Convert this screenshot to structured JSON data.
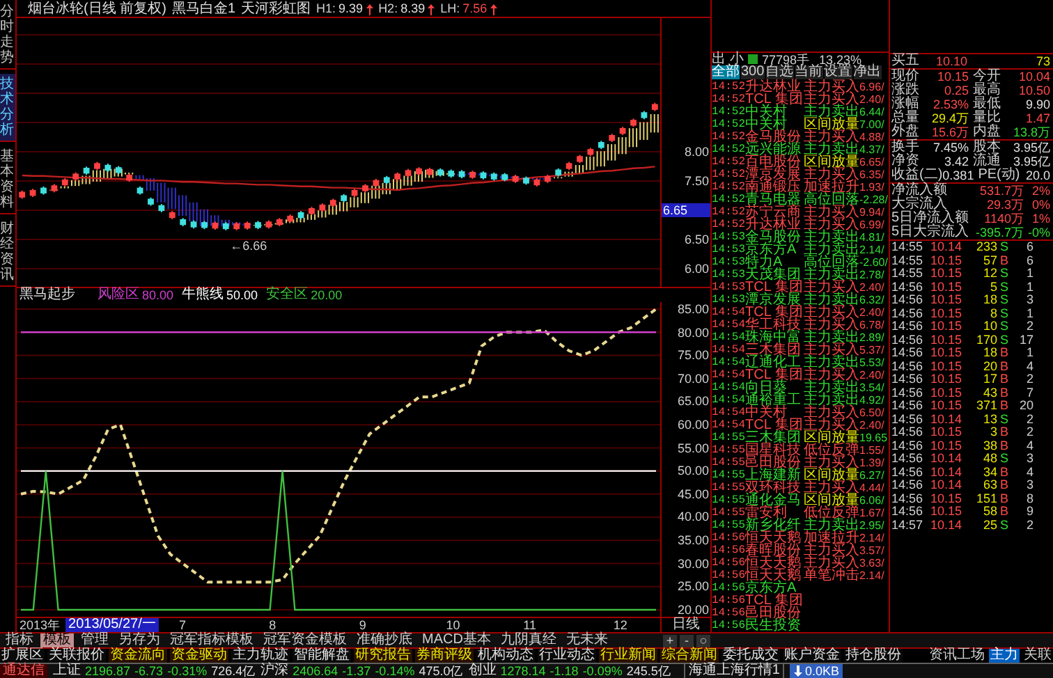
{
  "side_tabs": [
    {
      "label": "分时走势",
      "selected": false
    },
    {
      "label": "技术分析",
      "selected": true
    },
    {
      "label": "基本资料",
      "selected": false
    },
    {
      "label": "财经资讯",
      "selected": false
    }
  ],
  "chart_title": {
    "stock": "烟台冰轮(日线 前复权)",
    "indicator": "黑马白金1",
    "overlay": "天河彩虹图",
    "values": [
      {
        "label": "H1:",
        "value": "9.39",
        "color": "#e0e0e0"
      },
      {
        "label": "H2:",
        "value": "8.39",
        "color": "#e0e0e0"
      },
      {
        "label": "LH:",
        "value": "7.56",
        "color": "#ff4a4a"
      }
    ]
  },
  "price_chart": {
    "chart_data": {
      "type": "candlestick",
      "yticks": [
        {
          "value": 8,
          "label": "8.00"
        },
        {
          "value": 7.5,
          "label": "7.50"
        },
        {
          "value": 6.5,
          "label": "6.50"
        },
        {
          "value": 6,
          "label": "6.00"
        }
      ],
      "ylim": [
        5.67,
        10.29
      ],
      "grid": true,
      "categories": [
        null,
        null,
        null,
        null,
        null,
        null,
        null,
        null,
        null,
        null,
        null,
        null,
        null,
        null,
        null,
        null,
        null,
        null,
        null,
        null,
        null,
        null,
        null,
        null,
        null,
        null,
        null,
        null,
        null,
        null,
        null,
        null,
        null,
        null,
        null,
        null,
        null,
        null,
        null,
        null,
        null,
        null,
        null,
        null,
        null,
        null,
        null,
        null,
        null,
        null,
        null,
        null,
        null,
        null,
        null,
        null,
        null,
        null,
        null,
        null
      ],
      "series": [
        {
          "type": "line",
          "color": "#c02020",
          "values": [
            7.6,
            7.59,
            7.59,
            7.58,
            7.57,
            7.56,
            7.56,
            7.55,
            7.54,
            7.54,
            7.53,
            7.52,
            7.51,
            7.51,
            7.5,
            7.49,
            7.49,
            7.48,
            7.47,
            7.46,
            7.46,
            7.45,
            7.44,
            7.44,
            7.43,
            7.42,
            7.41,
            7.41,
            7.4,
            7.39,
            7.39,
            7.38,
            7.37,
            7.36,
            7.36,
            7.35,
            7.37,
            7.38,
            7.4,
            7.42,
            7.43,
            7.45,
            7.47,
            7.48,
            7.5,
            7.52,
            7.53,
            7.55,
            7.57,
            7.58,
            7.6,
            7.62,
            7.63,
            7.65,
            7.67,
            7.68,
            7.7,
            7.72,
            7.73,
            7.75
          ]
        }
      ],
      "ohlc": [
        [
          7.23,
          7.34,
          7.2,
          7.31
        ],
        [
          7.26,
          7.37,
          7.23,
          7.34
        ],
        [
          7.38,
          7.41,
          7.27,
          7.3
        ],
        [
          7.34,
          7.45,
          7.31,
          7.42
        ],
        [
          7.44,
          7.55,
          7.41,
          7.52
        ],
        [
          7.54,
          7.65,
          7.51,
          7.62
        ],
        [
          7.72,
          7.75,
          7.61,
          7.64
        ],
        [
          7.72,
          7.83,
          7.69,
          7.8
        ],
        [
          7.77,
          7.8,
          7.66,
          7.69
        ],
        [
          7.73,
          7.76,
          7.62,
          7.65
        ],
        [
          7.52,
          7.63,
          7.49,
          7.6
        ],
        [
          7.38,
          7.41,
          7.27,
          7.3
        ],
        [
          7.19,
          7.22,
          7.08,
          7.11
        ],
        [
          7.08,
          7.11,
          6.97,
          7.0
        ],
        [
          6.88,
          6.99,
          6.85,
          6.96
        ],
        [
          6.84,
          6.87,
          6.73,
          6.76
        ],
        [
          6.8,
          6.83,
          6.69,
          6.72
        ],
        [
          6.79,
          6.82,
          6.68,
          6.71
        ],
        [
          6.7,
          6.81,
          6.67,
          6.78
        ],
        [
          6.77,
          6.8,
          6.66,
          6.69
        ],
        [
          6.69,
          6.8,
          6.66,
          6.77
        ],
        [
          6.7,
          6.81,
          6.67,
          6.78
        ],
        [
          6.79,
          6.82,
          6.68,
          6.71
        ],
        [
          6.72,
          6.83,
          6.69,
          6.8
        ],
        [
          6.76,
          6.87,
          6.73,
          6.84
        ],
        [
          6.82,
          6.93,
          6.79,
          6.9
        ],
        [
          6.96,
          6.99,
          6.85,
          6.88
        ],
        [
          6.95,
          7.06,
          6.92,
          7.03
        ],
        [
          7.01,
          7.12,
          6.98,
          7.09
        ],
        [
          7.09,
          7.2,
          7.06,
          7.17
        ],
        [
          7.25,
          7.28,
          7.14,
          7.17
        ],
        [
          7.26,
          7.37,
          7.23,
          7.34
        ],
        [
          7.34,
          7.45,
          7.31,
          7.42
        ],
        [
          7.43,
          7.54,
          7.4,
          7.51
        ],
        [
          7.56,
          7.59,
          7.45,
          7.48
        ],
        [
          7.54,
          7.65,
          7.51,
          7.62
        ],
        [
          7.6,
          7.71,
          7.57,
          7.68
        ],
        [
          7.63,
          7.74,
          7.6,
          7.71
        ],
        [
          7.62,
          7.73,
          7.59,
          7.7
        ],
        [
          7.69,
          7.72,
          7.58,
          7.61
        ],
        [
          7.67,
          7.7,
          7.56,
          7.59
        ],
        [
          7.66,
          7.69,
          7.55,
          7.58
        ],
        [
          7.57,
          7.68,
          7.54,
          7.65
        ],
        [
          7.64,
          7.67,
          7.53,
          7.56
        ],
        [
          7.62,
          7.65,
          7.51,
          7.54
        ],
        [
          7.61,
          7.64,
          7.5,
          7.53
        ],
        [
          7.5,
          7.61,
          7.47,
          7.58
        ],
        [
          7.55,
          7.58,
          7.44,
          7.47
        ],
        [
          7.44,
          7.55,
          7.41,
          7.52
        ],
        [
          7.5,
          7.61,
          7.47,
          7.58
        ],
        [
          7.69,
          7.72,
          7.58,
          7.61
        ],
        [
          7.72,
          7.83,
          7.69,
          7.8
        ],
        [
          7.84,
          7.95,
          7.81,
          7.92
        ],
        [
          7.96,
          8.07,
          7.93,
          8.04
        ],
        [
          8.16,
          8.19,
          8.05,
          8.08
        ],
        [
          8.2,
          8.31,
          8.17,
          8.28
        ],
        [
          8.32,
          8.43,
          8.29,
          8.4
        ],
        [
          8.46,
          8.57,
          8.43,
          8.54
        ],
        [
          8.67,
          8.7,
          8.56,
          8.59
        ],
        [
          8.73,
          8.84,
          8.7,
          8.81
        ]
      ]
    }
  },
  "cursor_price": "6.65",
  "low_marker": "←6.66",
  "indicator": {
    "legend": [
      {
        "label": "风险区",
        "value": "80.00",
        "color": "#d040d0"
      },
      {
        "label": "牛熊线",
        "value": "50.00",
        "color": "#ffffff"
      },
      {
        "label": "安全区",
        "value": "20.00",
        "color": "#40c040"
      }
    ],
    "chart_data": {
      "type": "line",
      "title": "黑马起步",
      "ylim": [
        20,
        85
      ],
      "grid": true,
      "yticks": [
        {
          "value": 85,
          "label": "85.00"
        },
        {
          "value": 80,
          "label": "80.00"
        },
        {
          "value": 75,
          "label": "75.00"
        },
        {
          "value": 70,
          "label": "70.00"
        },
        {
          "value": 65,
          "label": "65.00"
        },
        {
          "value": 60,
          "label": "60.00"
        },
        {
          "value": 55,
          "label": "55.00"
        },
        {
          "value": 50,
          "label": "50.00"
        },
        {
          "value": 45,
          "label": "45.00"
        },
        {
          "value": 40,
          "label": "40.00"
        },
        {
          "value": 35,
          "label": "35.00"
        },
        {
          "value": 30,
          "label": "30.00"
        },
        {
          "value": 25,
          "label": "25.00"
        },
        {
          "value": 20,
          "label": "20.00"
        }
      ],
      "series": [
        {
          "color": "#e8d890",
          "line_style": "dashed",
          "values": [
            45,
            45.6,
            45.5,
            45,
            46.5,
            48,
            53,
            59,
            60,
            52,
            44,
            36,
            32,
            30,
            28,
            26,
            26,
            26,
            26,
            26,
            26,
            26.5,
            30,
            33,
            36,
            42,
            48,
            53,
            58,
            60,
            62,
            64,
            66,
            66,
            67,
            68,
            69,
            77,
            79,
            80,
            80,
            80,
            80.5,
            78,
            76,
            75,
            76,
            78,
            80,
            81,
            83,
            85
          ]
        },
        {
          "color": "#d040d0",
          "values": [
            80,
            80,
            80,
            80,
            80,
            80,
            80,
            80,
            80,
            80,
            80,
            80,
            80,
            80,
            80,
            80,
            80,
            80,
            80,
            80,
            80,
            80,
            80,
            80,
            80,
            80,
            80,
            80,
            80,
            80,
            80,
            80,
            80,
            80,
            80,
            80,
            80,
            80,
            80,
            80,
            80,
            80,
            80,
            80,
            80,
            80,
            80,
            80,
            80,
            80,
            80,
            80
          ]
        },
        {
          "color": "#ffffff",
          "values": [
            50,
            50,
            50,
            50,
            50,
            50,
            50,
            50,
            50,
            50,
            50,
            50,
            50,
            50,
            50,
            50,
            50,
            50,
            50,
            50,
            50,
            50,
            50,
            50,
            50,
            50,
            50,
            50,
            50,
            50,
            50,
            50,
            50,
            50,
            50,
            50,
            50,
            50,
            50,
            50,
            50,
            50,
            50,
            50,
            50,
            50,
            50,
            50,
            50,
            50,
            50,
            50
          ]
        },
        {
          "color": "#40c040",
          "values": [
            20,
            20,
            50,
            20,
            20,
            20,
            20,
            20,
            20,
            20,
            20,
            20,
            20,
            20,
            20,
            20,
            20,
            20,
            20,
            20,
            20,
            50,
            20,
            20,
            20,
            20,
            20,
            20,
            20,
            20,
            20,
            20,
            20,
            20,
            20,
            20,
            20,
            20,
            20,
            20,
            20,
            20,
            20,
            20,
            20,
            20,
            20,
            20,
            20,
            20,
            20,
            20
          ]
        }
      ]
    }
  },
  "date_axis": {
    "year": "2013年",
    "cursor_date": "2013/05/27/一",
    "ticks": [
      "7",
      "8",
      "9",
      "10",
      "11",
      "12"
    ],
    "period": "日线"
  },
  "feed": {
    "header": {
      "direction": "出",
      "size": "小",
      "volume": "77798手",
      "ratio": "13.23%"
    },
    "tabs": [
      {
        "label": "全部",
        "selected": true
      },
      {
        "label": "300",
        "selected": false
      },
      {
        "label": "自选",
        "selected": false
      },
      {
        "label": "当前",
        "selected": false
      },
      {
        "label": "设置",
        "selected": false
      },
      {
        "label": "净出",
        "selected": false
      }
    ],
    "rows": [
      {
        "time": "14:52",
        "name": "升达林业",
        "action": "主力买入",
        "value": "6.96/",
        "up": true,
        "kind": "buy"
      },
      {
        "time": "14:52",
        "name": "TCL 集团",
        "action": "主力买入",
        "value": "2.40/",
        "up": true,
        "kind": "buy"
      },
      {
        "time": "14:52",
        "name": "中关村",
        "action": "主力卖出",
        "value": "6.44/",
        "up": false,
        "kind": "sell"
      },
      {
        "time": "14:52",
        "name": "中关村",
        "action": "区间放量",
        "value": "7.00/",
        "up": false,
        "kind": "volume"
      },
      {
        "time": "14:52",
        "name": "金马股份",
        "action": "主力买入",
        "value": "4.88/",
        "up": true,
        "kind": "buy"
      },
      {
        "time": "14:52",
        "name": "远兴能源",
        "action": "主力卖出",
        "value": "4.37/",
        "up": false,
        "kind": "sell"
      },
      {
        "time": "14:52",
        "name": "百电股份",
        "action": "区间放量",
        "value": "6.65/",
        "up": true,
        "kind": "volume"
      },
      {
        "time": "14:52",
        "name": "潭京发展",
        "action": "主力买入",
        "value": "6.35/",
        "up": true,
        "kind": "buy"
      },
      {
        "time": "14:52",
        "name": "南通锻压",
        "action": "加速拉升",
        "value": "1.93/",
        "up": true,
        "kind": "buy"
      },
      {
        "time": "14:52",
        "name": "青马电器",
        "action": "高位回落",
        "value": "-2.28/",
        "up": false,
        "kind": "sell"
      },
      {
        "time": "14:52",
        "name": "苏宁云商",
        "action": "主力买入",
        "value": "9.94/",
        "up": true,
        "kind": "buy"
      },
      {
        "time": "14:52",
        "name": "升达林业",
        "action": "主力买入",
        "value": "6.99/",
        "up": true,
        "kind": "buy"
      },
      {
        "time": "14:53",
        "name": "金马股份",
        "action": "主力卖出",
        "value": "4.81/",
        "up": false,
        "kind": "sell"
      },
      {
        "time": "14:53",
        "name": "京东方A",
        "action": "主力卖出",
        "value": "2.14/",
        "up": false,
        "kind": "sell"
      },
      {
        "time": "14:53",
        "name": "特力A",
        "action": "高位回落",
        "value": "-2.60/",
        "up": false,
        "kind": "sell"
      },
      {
        "time": "14:53",
        "name": "天茂集团",
        "action": "主力卖出",
        "value": "2.78/",
        "up": false,
        "kind": "sell"
      },
      {
        "time": "14:53",
        "name": "TCL 集团",
        "action": "主力买入",
        "value": "2.40/",
        "up": true,
        "kind": "buy"
      },
      {
        "time": "14:53",
        "name": "潭京发展",
        "action": "主力卖出",
        "value": "6.32/",
        "up": false,
        "kind": "sell"
      },
      {
        "time": "14:54",
        "name": "TCL 集团",
        "action": "主力买入",
        "value": "2.40/",
        "up": true,
        "kind": "buy"
      },
      {
        "time": "14:54",
        "name": "华工科技",
        "action": "主力买入",
        "value": "6.78/",
        "up": true,
        "kind": "buy"
      },
      {
        "time": "14:54",
        "name": "珠海中富",
        "action": "主力卖出",
        "value": "2.89/",
        "up": false,
        "kind": "sell"
      },
      {
        "time": "14:54",
        "name": "三木集团",
        "action": "主力买入",
        "value": "5.37/",
        "up": true,
        "kind": "buy"
      },
      {
        "time": "14:54",
        "name": "辽通化工",
        "action": "主力卖出",
        "value": "5.53/",
        "up": false,
        "kind": "sell"
      },
      {
        "time": "14:54",
        "name": "TCL 集团",
        "action": "主力买入",
        "value": "2.40/",
        "up": true,
        "kind": "buy"
      },
      {
        "time": "14:54",
        "name": "向日葵",
        "action": "主力卖出",
        "value": "3.54/",
        "up": false,
        "kind": "sell"
      },
      {
        "time": "14:54",
        "name": "通裕重工",
        "action": "主力卖出",
        "value": "4.92/",
        "up": false,
        "kind": "sell"
      },
      {
        "time": "14:54",
        "name": "中关村",
        "action": "主力买入",
        "value": "6.50/",
        "up": true,
        "kind": "buy"
      },
      {
        "time": "14:54",
        "name": "TCL 集团",
        "action": "主力买入",
        "value": "2.40/",
        "up": true,
        "kind": "buy"
      },
      {
        "time": "14:55",
        "name": "三木集团",
        "action": "区间放量",
        "value": "19.65",
        "up": false,
        "kind": "volume"
      },
      {
        "time": "14:55",
        "name": "国星科技",
        "action": "低位反弹",
        "value": "1.55/",
        "up": true,
        "kind": "buy"
      },
      {
        "time": "14:55",
        "name": "邑田股份",
        "action": "主力买入",
        "value": "1.39/",
        "up": true,
        "kind": "buy"
      },
      {
        "time": "14:55",
        "name": "上海建新",
        "action": "区间放量",
        "value": "6.27/",
        "up": false,
        "kind": "volume"
      },
      {
        "time": "14:55",
        "name": "双环科技",
        "action": "主力买入",
        "value": "4.44/",
        "up": true,
        "kind": "buy"
      },
      {
        "time": "14:55",
        "name": "通化金马",
        "action": "区间放量",
        "value": "6.06/",
        "up": false,
        "kind": "volume"
      },
      {
        "time": "14:55",
        "name": "雷安利",
        "action": "低位反弹",
        "value": "1.67/",
        "up": true,
        "kind": "buy"
      },
      {
        "time": "14:55",
        "name": "新乡化纤",
        "action": "主力卖出",
        "value": "2.95/",
        "up": false,
        "kind": "sell"
      },
      {
        "time": "14:56",
        "name": "恒天天鹅",
        "action": "加速拉升",
        "value": "2.14/",
        "up": true,
        "kind": "buy"
      },
      {
        "time": "14:56",
        "name": "春晖股份",
        "action": "主力买入",
        "value": "3.57/",
        "up": true,
        "kind": "buy"
      },
      {
        "time": "14:56",
        "name": "恒天天鹅",
        "action": "主力买入",
        "value": "3.63/",
        "up": true,
        "kind": "buy"
      },
      {
        "time": "14:56",
        "name": "恒天天鹅",
        "action": "单笔冲击",
        "value": "2.14/",
        "up": true,
        "kind": "buy"
      },
      {
        "time": "14:56",
        "name": "京东方A",
        "up": false
      },
      {
        "time": "14:56",
        "name": "TCL 集团",
        "up": true
      },
      {
        "time": "14:56",
        "name": "邑田股份",
        "up": true
      },
      {
        "time": "14:56",
        "name": "民生投资",
        "up": false
      }
    ]
  },
  "quote": [
    [
      {
        "kind": "level",
        "label": "买五",
        "price": "10.10",
        "volume": "73"
      }
    ],
    [
      {
        "kind": "pair",
        "cells": [
          {
            "label": "现价",
            "value": "10.15",
            "color": "#ff4a4a"
          },
          {
            "label": "今开",
            "value": "10.04",
            "color": "#ff4a4a"
          }
        ]
      },
      {
        "kind": "pair",
        "cells": [
          {
            "label": "涨跌",
            "value": "0.25",
            "color": "#ff4a4a"
          },
          {
            "label": "最高",
            "value": "10.50",
            "color": "#ff4a4a"
          }
        ]
      },
      {
        "kind": "pair",
        "cells": [
          {
            "label": "涨幅",
            "value": "2.53%",
            "color": "#ff4a4a"
          },
          {
            "label": "最低",
            "value": "9.90",
            "color": "#e0e0e0"
          }
        ]
      },
      {
        "kind": "pair",
        "cells": [
          {
            "label": "总量",
            "value": "29.4万",
            "color": "#e8e800"
          },
          {
            "label": "量比",
            "value": "1.47",
            "color": "#ff4a4a"
          }
        ]
      },
      {
        "kind": "pair",
        "cells": [
          {
            "label": "外盘",
            "value": "15.6万",
            "color": "#ff4a4a"
          },
          {
            "label": "内盘",
            "value": "13.8万",
            "color": "#33dd33"
          }
        ]
      }
    ],
    [
      {
        "kind": "pair",
        "cells": [
          {
            "label": "换手",
            "value": "7.45%",
            "color": "#e0e0e0"
          },
          {
            "label": "股本",
            "value": "3.95亿",
            "color": "#e0e0e0"
          }
        ]
      },
      {
        "kind": "pair",
        "cells": [
          {
            "label": "净资",
            "value": "3.42",
            "color": "#e0e0e0"
          },
          {
            "label": "流通",
            "value": "3.95亿",
            "color": "#e0e0e0"
          }
        ]
      },
      {
        "kind": "pair",
        "cells": [
          {
            "label": "收益(二)",
            "value": "0.381",
            "color": "#e0e0e0"
          },
          {
            "label": "PE(动)",
            "value": "20.0",
            "color": "#e0e0e0"
          }
        ]
      }
    ],
    [
      {
        "kind": "flow",
        "label": "净流入额",
        "value": "531.7万",
        "pct": "2%",
        "color": "#ff4a4a"
      },
      {
        "kind": "flow",
        "label": "大宗流入",
        "value": "29.3万",
        "pct": "0%",
        "color": "#ff4a4a"
      },
      {
        "kind": "flow",
        "label": "5日净流入额",
        "value": "1140万",
        "pct": "1%",
        "color": "#ff4a4a"
      },
      {
        "kind": "flow",
        "label": "5日大宗流入",
        "value": "-395.7万",
        "pct": "-0%",
        "color": "#33dd33"
      }
    ]
  ],
  "ticks": [
    {
      "time": "14:55",
      "price": "10.14",
      "volume": "233",
      "side": "S",
      "buy": false,
      "count": "6"
    },
    {
      "time": "14:55",
      "price": "10.15",
      "volume": "57",
      "side": "B",
      "buy": true,
      "count": "6"
    },
    {
      "time": "14:55",
      "price": "10.15",
      "volume": "12",
      "side": "S",
      "buy": false,
      "count": "1"
    },
    {
      "time": "14:56",
      "price": "10.15",
      "volume": "5",
      "side": "S",
      "buy": false,
      "count": "1"
    },
    {
      "time": "14:56",
      "price": "10.15",
      "volume": "18",
      "side": "S",
      "buy": false,
      "count": "3"
    },
    {
      "time": "14:56",
      "price": "10.15",
      "volume": "8",
      "side": "S",
      "buy": false,
      "count": "1"
    },
    {
      "time": "14:56",
      "price": "10.15",
      "volume": "10",
      "side": "S",
      "buy": false,
      "count": "2"
    },
    {
      "time": "14:56",
      "price": "10.15",
      "volume": "170",
      "side": "S",
      "buy": false,
      "count": "17"
    },
    {
      "time": "14:56",
      "price": "10.15",
      "volume": "18",
      "side": "B",
      "buy": true,
      "count": "1"
    },
    {
      "time": "14:56",
      "price": "10.15",
      "volume": "20",
      "side": "B",
      "buy": true,
      "count": "4"
    },
    {
      "time": "14:56",
      "price": "10.15",
      "volume": "17",
      "side": "B",
      "buy": true,
      "count": "2"
    },
    {
      "time": "14:56",
      "price": "10.15",
      "volume": "43",
      "side": "B",
      "buy": true,
      "count": "7"
    },
    {
      "time": "14:56",
      "price": "10.15",
      "volume": "371",
      "side": "B",
      "buy": true,
      "count": "20"
    },
    {
      "time": "14:56",
      "price": "10.14",
      "volume": "13",
      "side": "S",
      "buy": false,
      "count": "2"
    },
    {
      "time": "14:56",
      "price": "10.15",
      "volume": "3",
      "side": "B",
      "buy": true,
      "count": "2"
    },
    {
      "time": "14:56",
      "price": "10.15",
      "volume": "38",
      "side": "B",
      "buy": true,
      "count": "4"
    },
    {
      "time": "14:56",
      "price": "10.14",
      "volume": "48",
      "side": "S",
      "buy": false,
      "count": "3"
    },
    {
      "time": "14:56",
      "price": "10.14",
      "volume": "34",
      "side": "B",
      "buy": true,
      "count": "4"
    },
    {
      "time": "14:56",
      "price": "10.14",
      "volume": "63",
      "side": "B",
      "buy": true,
      "count": "3"
    },
    {
      "time": "14:56",
      "price": "10.15",
      "volume": "151",
      "side": "B",
      "buy": true,
      "count": "8"
    },
    {
      "time": "14:56",
      "price": "10.15",
      "volume": "58",
      "side": "B",
      "buy": true,
      "count": "9"
    },
    {
      "time": "14:57",
      "price": "10.14",
      "volume": "25",
      "side": "S",
      "buy": false,
      "count": "2"
    }
  ],
  "template_tabs": [
    {
      "label": "指标",
      "selected": false
    },
    {
      "label": "模板",
      "selected": true
    },
    {
      "label": "管理",
      "selected": false
    },
    {
      "label": "另存为",
      "selected": false
    },
    {
      "label": "冠军指标模板",
      "selected": false
    },
    {
      "label": "冠军资金模板",
      "selected": false
    },
    {
      "label": "准确抄底",
      "selected": false
    },
    {
      "label": "MACD基本",
      "selected": false
    },
    {
      "label": "九阴真经",
      "selected": false
    },
    {
      "label": "无未来",
      "selected": false
    }
  ],
  "zoom_buttons": [
    "+",
    "-",
    "○"
  ],
  "info_tabs": [
    {
      "label": "扩展区",
      "highlighted": false
    },
    {
      "label": "关联报价",
      "highlighted": false
    },
    {
      "label": "资金流向",
      "highlighted": true
    },
    {
      "label": "资金驱动",
      "highlighted": true
    },
    {
      "label": "主力轨迹",
      "highlighted": false
    },
    {
      "label": "智能解盘",
      "highlighted": false
    },
    {
      "label": "研究报告",
      "highlighted": true
    },
    {
      "label": "券商评级",
      "highlighted": true
    },
    {
      "label": "机构动态",
      "highlighted": false
    },
    {
      "label": "行业动态",
      "highlighted": false
    },
    {
      "label": "行业新闻",
      "highlighted": true
    },
    {
      "label": "综合新闻",
      "highlighted": true
    },
    {
      "label": "委托成交",
      "highlighted": false
    },
    {
      "label": "账户资金",
      "highlighted": false
    },
    {
      "label": "持仓股份",
      "highlighted": false
    }
  ],
  "panel_tabs": [
    {
      "label": "资讯工场",
      "selected": false
    },
    {
      "label": "主力",
      "selected": true
    },
    {
      "label": "关联",
      "selected": false
    }
  ],
  "status_bar": {
    "brand": "通达信",
    "indices": [
      {
        "name": "上证",
        "value": "2196.87",
        "change": "-6.73",
        "pct": "-0.31%",
        "amount": "726.4亿"
      },
      {
        "name": "沪深",
        "value": "2406.64",
        "change": "-1.37",
        "pct": "-0.14%",
        "amount": "475.0亿"
      },
      {
        "name": "创业",
        "value": "1278.14",
        "change": "-1.18",
        "pct": "-0.09%",
        "amount": "245.5亿"
      }
    ],
    "server": "海通上海行情1",
    "traffic": "0.0KB"
  }
}
